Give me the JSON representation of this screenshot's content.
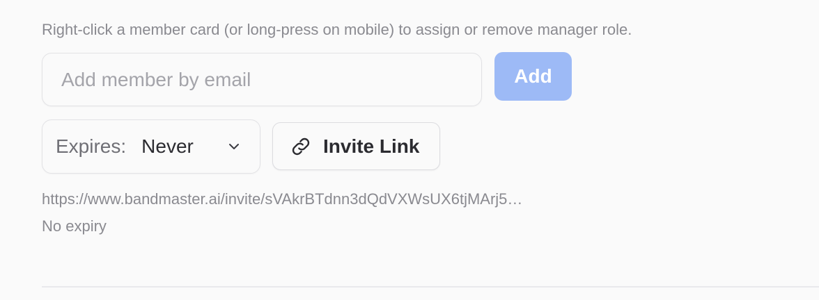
{
  "help_text": "Right-click a member card (or long-press on mobile) to assign or remove manager role.",
  "add_member": {
    "placeholder": "Add member by email",
    "value": "",
    "button_label": "Add",
    "button_color": "#9dbaf6"
  },
  "expires": {
    "label": "Expires:",
    "selected": "Never",
    "icon": "chevron-down-icon"
  },
  "invite": {
    "button_label": "Invite Link",
    "icon": "link-icon",
    "url": "https://www.bandmaster.ai/invite/sVAkrBTdnn3dQdVXWsUX6tjMArj5…",
    "expiry_text": "No expiry"
  }
}
